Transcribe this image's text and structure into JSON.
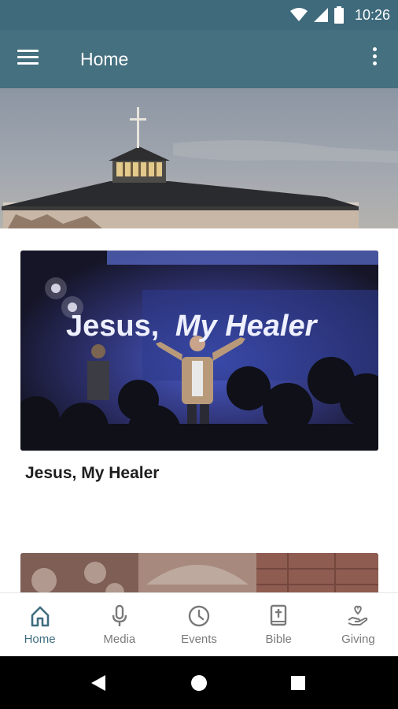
{
  "status_bar": {
    "time": "10:26"
  },
  "app_bar": {
    "title": "Home",
    "menu_icon": "hamburger-menu-icon",
    "more_icon": "more-vert-icon"
  },
  "hero": {
    "alt": "church-building-photo"
  },
  "cards": [
    {
      "image_text_line1": "Jesus,",
      "image_text_line2": "My Healer",
      "caption": "Jesus, My Healer"
    },
    {
      "image": "collage-photo"
    }
  ],
  "bottom_nav": {
    "items": [
      {
        "label": "Home",
        "icon": "home-icon",
        "active": true
      },
      {
        "label": "Media",
        "icon": "microphone-icon",
        "active": false
      },
      {
        "label": "Events",
        "icon": "clock-icon",
        "active": false
      },
      {
        "label": "Bible",
        "icon": "bible-icon",
        "active": false
      },
      {
        "label": "Giving",
        "icon": "giving-hand-icon",
        "active": false
      }
    ]
  },
  "colors": {
    "app_bar": "#45707f",
    "status_bar": "#3e6a7c",
    "active_nav": "#3f6d80",
    "inactive_nav": "#7a7a7a"
  }
}
